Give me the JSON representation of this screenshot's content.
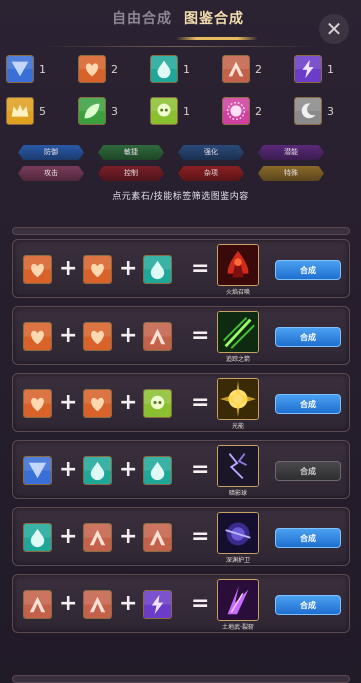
{
  "header": {
    "tab_free": "自由合成",
    "tab_codex": "图鉴合成",
    "close_glyph": "✕"
  },
  "materials": [
    {
      "icon": "shield-icon",
      "color": "#3a6fd6",
      "count": "1"
    },
    {
      "icon": "heart-icon",
      "color": "#d8622a",
      "count": "2"
    },
    {
      "icon": "drop-icon",
      "color": "#1fa89a",
      "count": "1"
    },
    {
      "icon": "arch-icon",
      "color": "#c4614a",
      "count": "2"
    },
    {
      "icon": "lightning-icon",
      "color": "#6a3cc8",
      "count": "1"
    },
    {
      "icon": "crown-icon",
      "color": "#e0a020",
      "count": "5"
    },
    {
      "icon": "leaf-icon",
      "color": "#3aa040",
      "count": "3"
    },
    {
      "icon": "skull-icon",
      "color": "#8ac030",
      "count": "1"
    },
    {
      "icon": "sun-icon",
      "color": "#d040a0",
      "count": "2"
    },
    {
      "icon": "moon-icon",
      "color": "#8a8a8a",
      "count": "3"
    }
  ],
  "filters": [
    {
      "label": "防御",
      "color": "#2a5aa8"
    },
    {
      "label": "敏捷",
      "color": "#2f6a3c"
    },
    {
      "label": "强化",
      "color": "#2a4a7a"
    },
    {
      "label": "潜能",
      "color": "#5a2a7a"
    },
    {
      "label": "攻击",
      "color": "#7a3c5a"
    },
    {
      "label": "控制",
      "color": "#7a1f2a"
    },
    {
      "label": "杂项",
      "color": "#8a1f22"
    },
    {
      "label": "特殊",
      "color": "#8a6a2a"
    }
  ],
  "hint": "点元素石/技能标签筛选图鉴内容",
  "recipes": [
    {
      "ingredients": [
        "heart-icon",
        "heart-icon",
        "drop-icon"
      ],
      "result_icon": "fire-tower-icon",
      "result_name": "火焰召唤",
      "craft": "合成",
      "enabled": true
    },
    {
      "ingredients": [
        "heart-icon",
        "heart-icon",
        "arch-icon"
      ],
      "result_icon": "arrow-rain-icon",
      "result_name": "追踪之箭",
      "craft": "合成",
      "enabled": true
    },
    {
      "ingredients": [
        "heart-icon",
        "heart-icon",
        "skull-icon"
      ],
      "result_icon": "light-burst-icon",
      "result_name": "光能",
      "craft": "合成",
      "enabled": true
    },
    {
      "ingredients": [
        "shield-icon",
        "drop-icon",
        "drop-icon"
      ],
      "result_icon": "lightning-cage-icon",
      "result_name": "暗影球",
      "craft": "合成",
      "enabled": false
    },
    {
      "ingredients": [
        "drop-icon",
        "arch-icon",
        "arch-icon"
      ],
      "result_icon": "void-orb-icon",
      "result_name": "深渊护卫",
      "craft": "合成",
      "enabled": true
    },
    {
      "ingredients": [
        "arch-icon",
        "arch-icon",
        "lightning-icon"
      ],
      "result_icon": "purple-blades-icon",
      "result_name": "土地武·裂斩",
      "craft": "合成",
      "enabled": true
    }
  ]
}
